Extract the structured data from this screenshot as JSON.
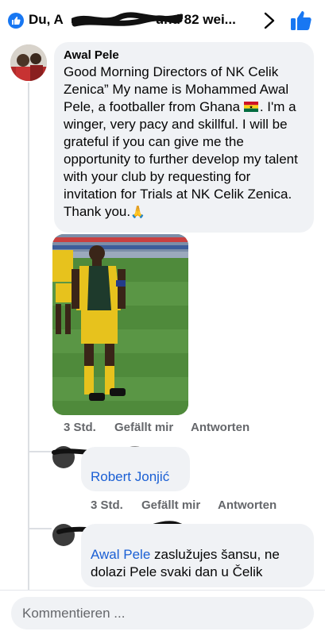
{
  "header": {
    "title": "Du, A          und 82 wei...",
    "title_prefix": "Du, A",
    "title_suffix": "und 82 wei..."
  },
  "comment": {
    "author": "Awal Pele",
    "text": "Good Morning Directors of NK Celik Zenica” My name is Mohammed Awal Pele, a footballer from Ghana",
    "text_after_flag": ". I'm a winger, very pacy and skillful. I will be grateful if you can give me the opportunity to further develop my talent with your club by requesting for invitation for Trials at NK Celik Zenica. Thank you.",
    "time": "3 Std.",
    "like": "Gefällt mir",
    "reply": "Antworten"
  },
  "reply1": {
    "mention": "Robert Jonjić",
    "time": "3 Std.",
    "like": "Gefällt mir",
    "reply": "Antworten"
  },
  "reply2": {
    "mention": "Awal Pele",
    "text": " zaslužujes šansu, ne dolazi Pele svaki dan u Čelik"
  },
  "composer": {
    "placeholder": "Kommentieren ..."
  },
  "icons": [
    "like-icon",
    "chevron-right-icon",
    "thumbs-up-icon",
    "ghana-flag-icon",
    "praying-hands-icon"
  ],
  "colors": {
    "accent": "#1877f2",
    "bubble": "#f0f2f5",
    "link": "#1a5fd4",
    "meta": "#65676b"
  }
}
